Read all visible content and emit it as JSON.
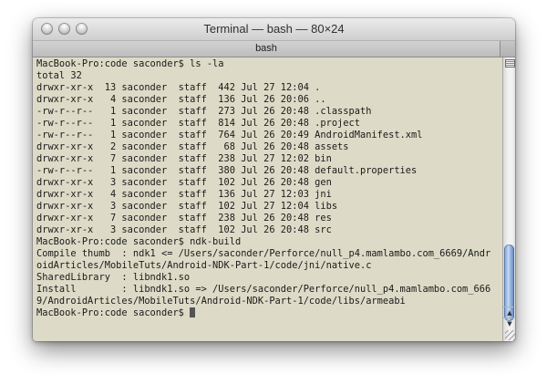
{
  "window": {
    "title": "Terminal — bash — 80×24"
  },
  "tabs": [
    {
      "label": "bash"
    }
  ],
  "colors": {
    "terminal_background": "#dddbc7",
    "terminal_text": "#1a1a1a",
    "cursor": "#545454",
    "scroll_thumb": "#9bb9e2"
  },
  "icons": {
    "close": "close-icon",
    "minimize": "minimize-icon",
    "zoom": "zoom-icon",
    "split_pane": "split-pane-icon",
    "scroll_up": "up-arrow-icon",
    "scroll_down": "down-arrow-icon",
    "resize": "resize-grip-icon"
  },
  "scroll_arrows": {
    "up": "▲",
    "down": "▼"
  },
  "terminal": {
    "lines": [
      "MacBook-Pro:code saconder$ ls -la",
      "total 32",
      "drwxr-xr-x  13 saconder  staff  442 Jul 27 12:04 .",
      "drwxr-xr-x   4 saconder  staff  136 Jul 26 20:06 ..",
      "-rw-r--r--   1 saconder  staff  273 Jul 26 20:48 .classpath",
      "-rw-r--r--   1 saconder  staff  814 Jul 26 20:48 .project",
      "-rw-r--r--   1 saconder  staff  764 Jul 26 20:49 AndroidManifest.xml",
      "drwxr-xr-x   2 saconder  staff   68 Jul 26 20:48 assets",
      "drwxr-xr-x   7 saconder  staff  238 Jul 27 12:02 bin",
      "-rw-r--r--   1 saconder  staff  380 Jul 26 20:48 default.properties",
      "drwxr-xr-x   3 saconder  staff  102 Jul 26 20:48 gen",
      "drwxr-xr-x   4 saconder  staff  136 Jul 27 12:03 jni",
      "drwxr-xr-x   3 saconder  staff  102 Jul 27 12:04 libs",
      "drwxr-xr-x   7 saconder  staff  238 Jul 26 20:48 res",
      "drwxr-xr-x   3 saconder  staff  102 Jul 26 20:48 src",
      "MacBook-Pro:code saconder$ ndk-build",
      "Compile thumb  : ndk1 <= /Users/saconder/Perforce/null_p4.mamlambo.com_6669/Andr",
      "oidArticles/MobileTuts/Android-NDK-Part-1/code/jni/native.c",
      "SharedLibrary  : libndk1.so",
      "Install        : libndk1.so => /Users/saconder/Perforce/null_p4.mamlambo.com_666",
      "9/AndroidArticles/MobileTuts/Android-NDK-Part-1/code/libs/armeabi"
    ],
    "prompt": "MacBook-Pro:code saconder$ "
  }
}
